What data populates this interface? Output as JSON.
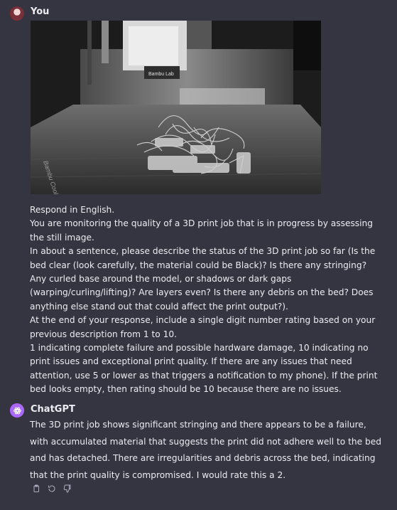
{
  "user": {
    "name": "You"
  },
  "image": {
    "printer_brand_label": "Bambu Lab",
    "plate_label": "Bambu Cool Plate"
  },
  "prompt_lines": [
    "Respond in English.",
    "You are monitoring the quality of a 3D print job that is in progress by assessing the still image.",
    "In about a sentence, please describe the status of the 3D print job so far (Is the bed clear (look carefully, the material could be Black)? Is there any stringing? Any curled base around the model, or shadows or dark gaps (warping/curling/lifting)? Are layers even? Is there any debris on the bed? Does anything else stand out that could affect the print output?).",
    "At the end of your response, include a single digit number rating based on your previous description from 1 to 10.",
    "1 indicating complete failure and possible hardware damage, 10 indicating no print issues and exceptional print quality. If there are any issues that need attention, use 5 or lower as that triggers a notification to my phone). If the print bed looks empty, then rating should be 10 because there are no issues."
  ],
  "assistant": {
    "name": "ChatGPT",
    "response": "The 3D print job shows significant stringing and there appears to be a failure, with accumulated material that suggests the print did not adhere well to the bed and has detached. There are irregularities and debris across the bed, indicating that the print quality is compromised. I would rate this a 2."
  },
  "actions": {
    "icons": [
      "clipboard-icon",
      "regenerate-icon",
      "thumbs-down-icon"
    ]
  },
  "colors": {
    "background": "#343541",
    "text": "#ececf1",
    "gpt_avatar": "#ab68ff",
    "muted_icon": "#acacbe"
  }
}
